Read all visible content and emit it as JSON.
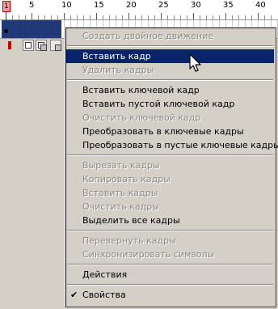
{
  "timeline": {
    "playhead_frame": "1",
    "ruler_numbers": [
      "5",
      "10",
      "15",
      "20",
      "25",
      "30",
      "35",
      "40"
    ]
  },
  "menu": {
    "items": [
      {
        "label": "Создать двойное движение",
        "enabled": false
      },
      {
        "separator": true
      },
      {
        "label": "Вставить кадр",
        "enabled": true,
        "selected": true
      },
      {
        "label": "Удалить кадры",
        "enabled": false
      },
      {
        "separator": true
      },
      {
        "label": "Вставить ключевой кадр",
        "enabled": true
      },
      {
        "label": "Вставить пустой ключевой кадр",
        "enabled": true
      },
      {
        "label": "Очистить ключевой кадр",
        "enabled": false
      },
      {
        "label": "Преобразовать в ключевые кадры",
        "enabled": true
      },
      {
        "label": "Преобразовать в пустые ключевые кадры",
        "enabled": true
      },
      {
        "separator": true
      },
      {
        "label": "Вырезать кадры",
        "enabled": false
      },
      {
        "label": "Копировать кадры",
        "enabled": false
      },
      {
        "label": "Вставить кадры",
        "enabled": false
      },
      {
        "label": "Очистить кадры",
        "enabled": false
      },
      {
        "label": "Выделить все кадры",
        "enabled": true
      },
      {
        "separator": true
      },
      {
        "label": "Перевернуть кадры",
        "enabled": false
      },
      {
        "label": "Синхронизировать символы",
        "enabled": false
      },
      {
        "separator": true
      },
      {
        "label": "Действия",
        "enabled": true
      },
      {
        "separator": true
      },
      {
        "label": "Свойства",
        "enabled": true,
        "checked": true
      }
    ],
    "check_glyph": "✔"
  },
  "colors": {
    "selection": "#0a246a",
    "disabled_text": "#8c8a84",
    "playhead": "#ff9a9a"
  }
}
